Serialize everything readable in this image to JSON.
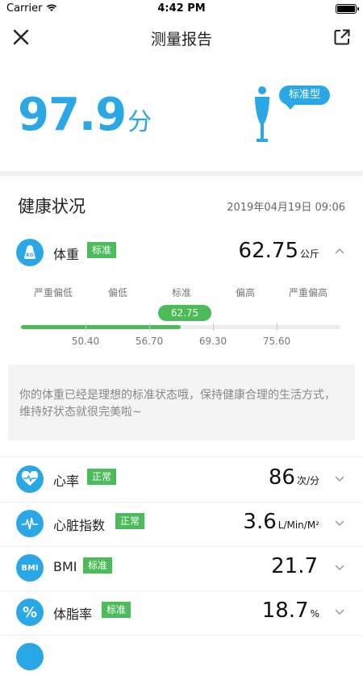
{
  "status_bar": {
    "carrier": "Carrier",
    "time": "4:42 PM"
  },
  "nav": {
    "title": "测量报告"
  },
  "score": {
    "value": "97.9",
    "unit": "分",
    "body_type": "标准型"
  },
  "section": {
    "title": "健康状况",
    "date": "2019年04月19日 09:06"
  },
  "weight": {
    "name": "体重",
    "tag": "标准",
    "value": "62.75",
    "unit": "公斤",
    "scale_labels": [
      "严重偏低",
      "偏低",
      "标准",
      "偏高",
      "严重偏高"
    ],
    "marker": "62.75",
    "thresholds": [
      "50.40",
      "56.70",
      "69.30",
      "75.60"
    ],
    "progress_fraction": 0.5,
    "advice": "你的体重已经是理想的标准状态哦，保持健康合理的生活方式，维持好状态就很完美啦~"
  },
  "metrics": [
    {
      "name": "心率",
      "tag": "正常",
      "value": "86",
      "unit": "次/分",
      "icon": "heart-rate-icon",
      "icon_text": ""
    },
    {
      "name": "心脏指数",
      "tag": "正常",
      "value": "3.6",
      "unit": "L/Min/M²",
      "icon": "heart-index-icon",
      "icon_text": ""
    },
    {
      "name": "BMI",
      "tag": "标准",
      "value": "21.7",
      "unit": "",
      "icon": "bmi-icon",
      "icon_text": "BMI"
    },
    {
      "name": "体脂率",
      "tag": "标准",
      "value": "18.7",
      "unit": "%",
      "icon": "percent-icon",
      "icon_text": "%"
    }
  ],
  "colors": {
    "accent": "#29a7e6",
    "good": "#4cbb5a"
  }
}
